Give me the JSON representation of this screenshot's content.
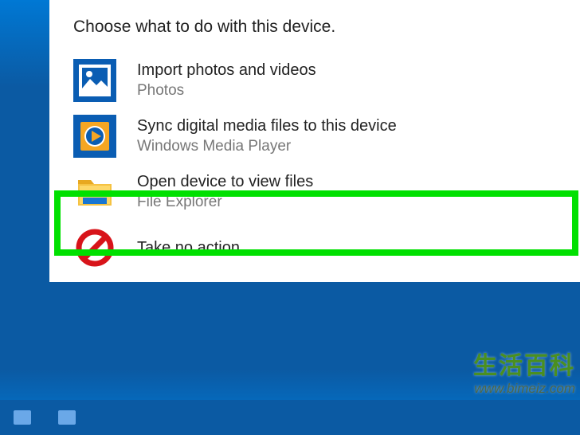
{
  "panel": {
    "heading": "Choose what to do with this device.",
    "options": [
      {
        "title": "Import photos and videos",
        "subtitle": "Photos"
      },
      {
        "title": "Sync digital media files to this device",
        "subtitle": "Windows Media Player"
      },
      {
        "title": "Open device to view files",
        "subtitle": "File Explorer"
      },
      {
        "title": "Take no action",
        "subtitle": ""
      }
    ]
  },
  "highlight": {
    "target_index": 2,
    "color": "#00e000"
  },
  "watermark": {
    "text_cn": "生活百科",
    "url": "www.bimeiz.com"
  },
  "colors": {
    "accent": "#0078d4",
    "panel_bg": "#ffffff",
    "icon_bg": "#0a5db3"
  }
}
